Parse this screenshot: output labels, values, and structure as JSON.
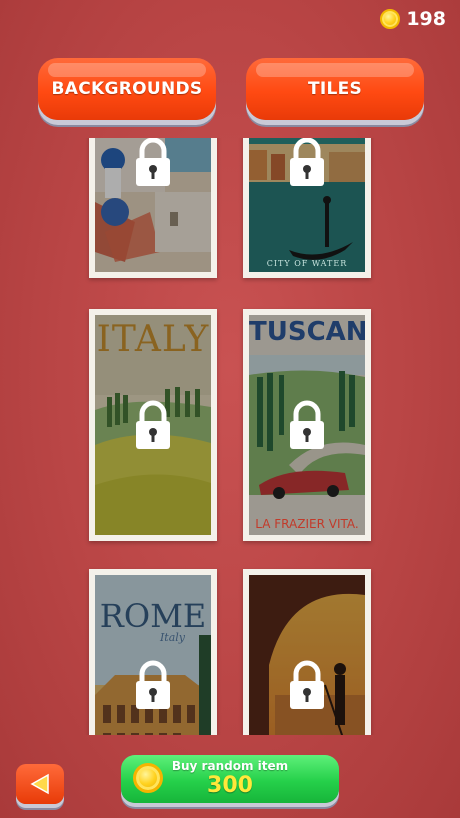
{
  "hud": {
    "coins": "198",
    "coin_icon": "coin-icon"
  },
  "tabs": [
    {
      "label": "BACKGROUNDS"
    },
    {
      "label": "TILES"
    }
  ],
  "cards": [
    {
      "id": "santorini",
      "locked": true,
      "caption": ""
    },
    {
      "id": "venice",
      "locked": true,
      "caption": "CITY OF WATER"
    },
    {
      "id": "italy",
      "locked": true,
      "title": "ITALY"
    },
    {
      "id": "tuscany",
      "locked": true,
      "title": "TUSCANY",
      "caption": "LA FRAZIER VITA."
    },
    {
      "id": "rome",
      "locked": true,
      "title": "ROME",
      "subtitle": "Italy"
    },
    {
      "id": "gondolier",
      "locked": true
    }
  ],
  "buy": {
    "label": "Buy random item",
    "price": "300"
  },
  "colors": {
    "background": "#b94545",
    "tab": "#ff4a12",
    "buy": "#25d04a",
    "price": "#ffe83a"
  }
}
